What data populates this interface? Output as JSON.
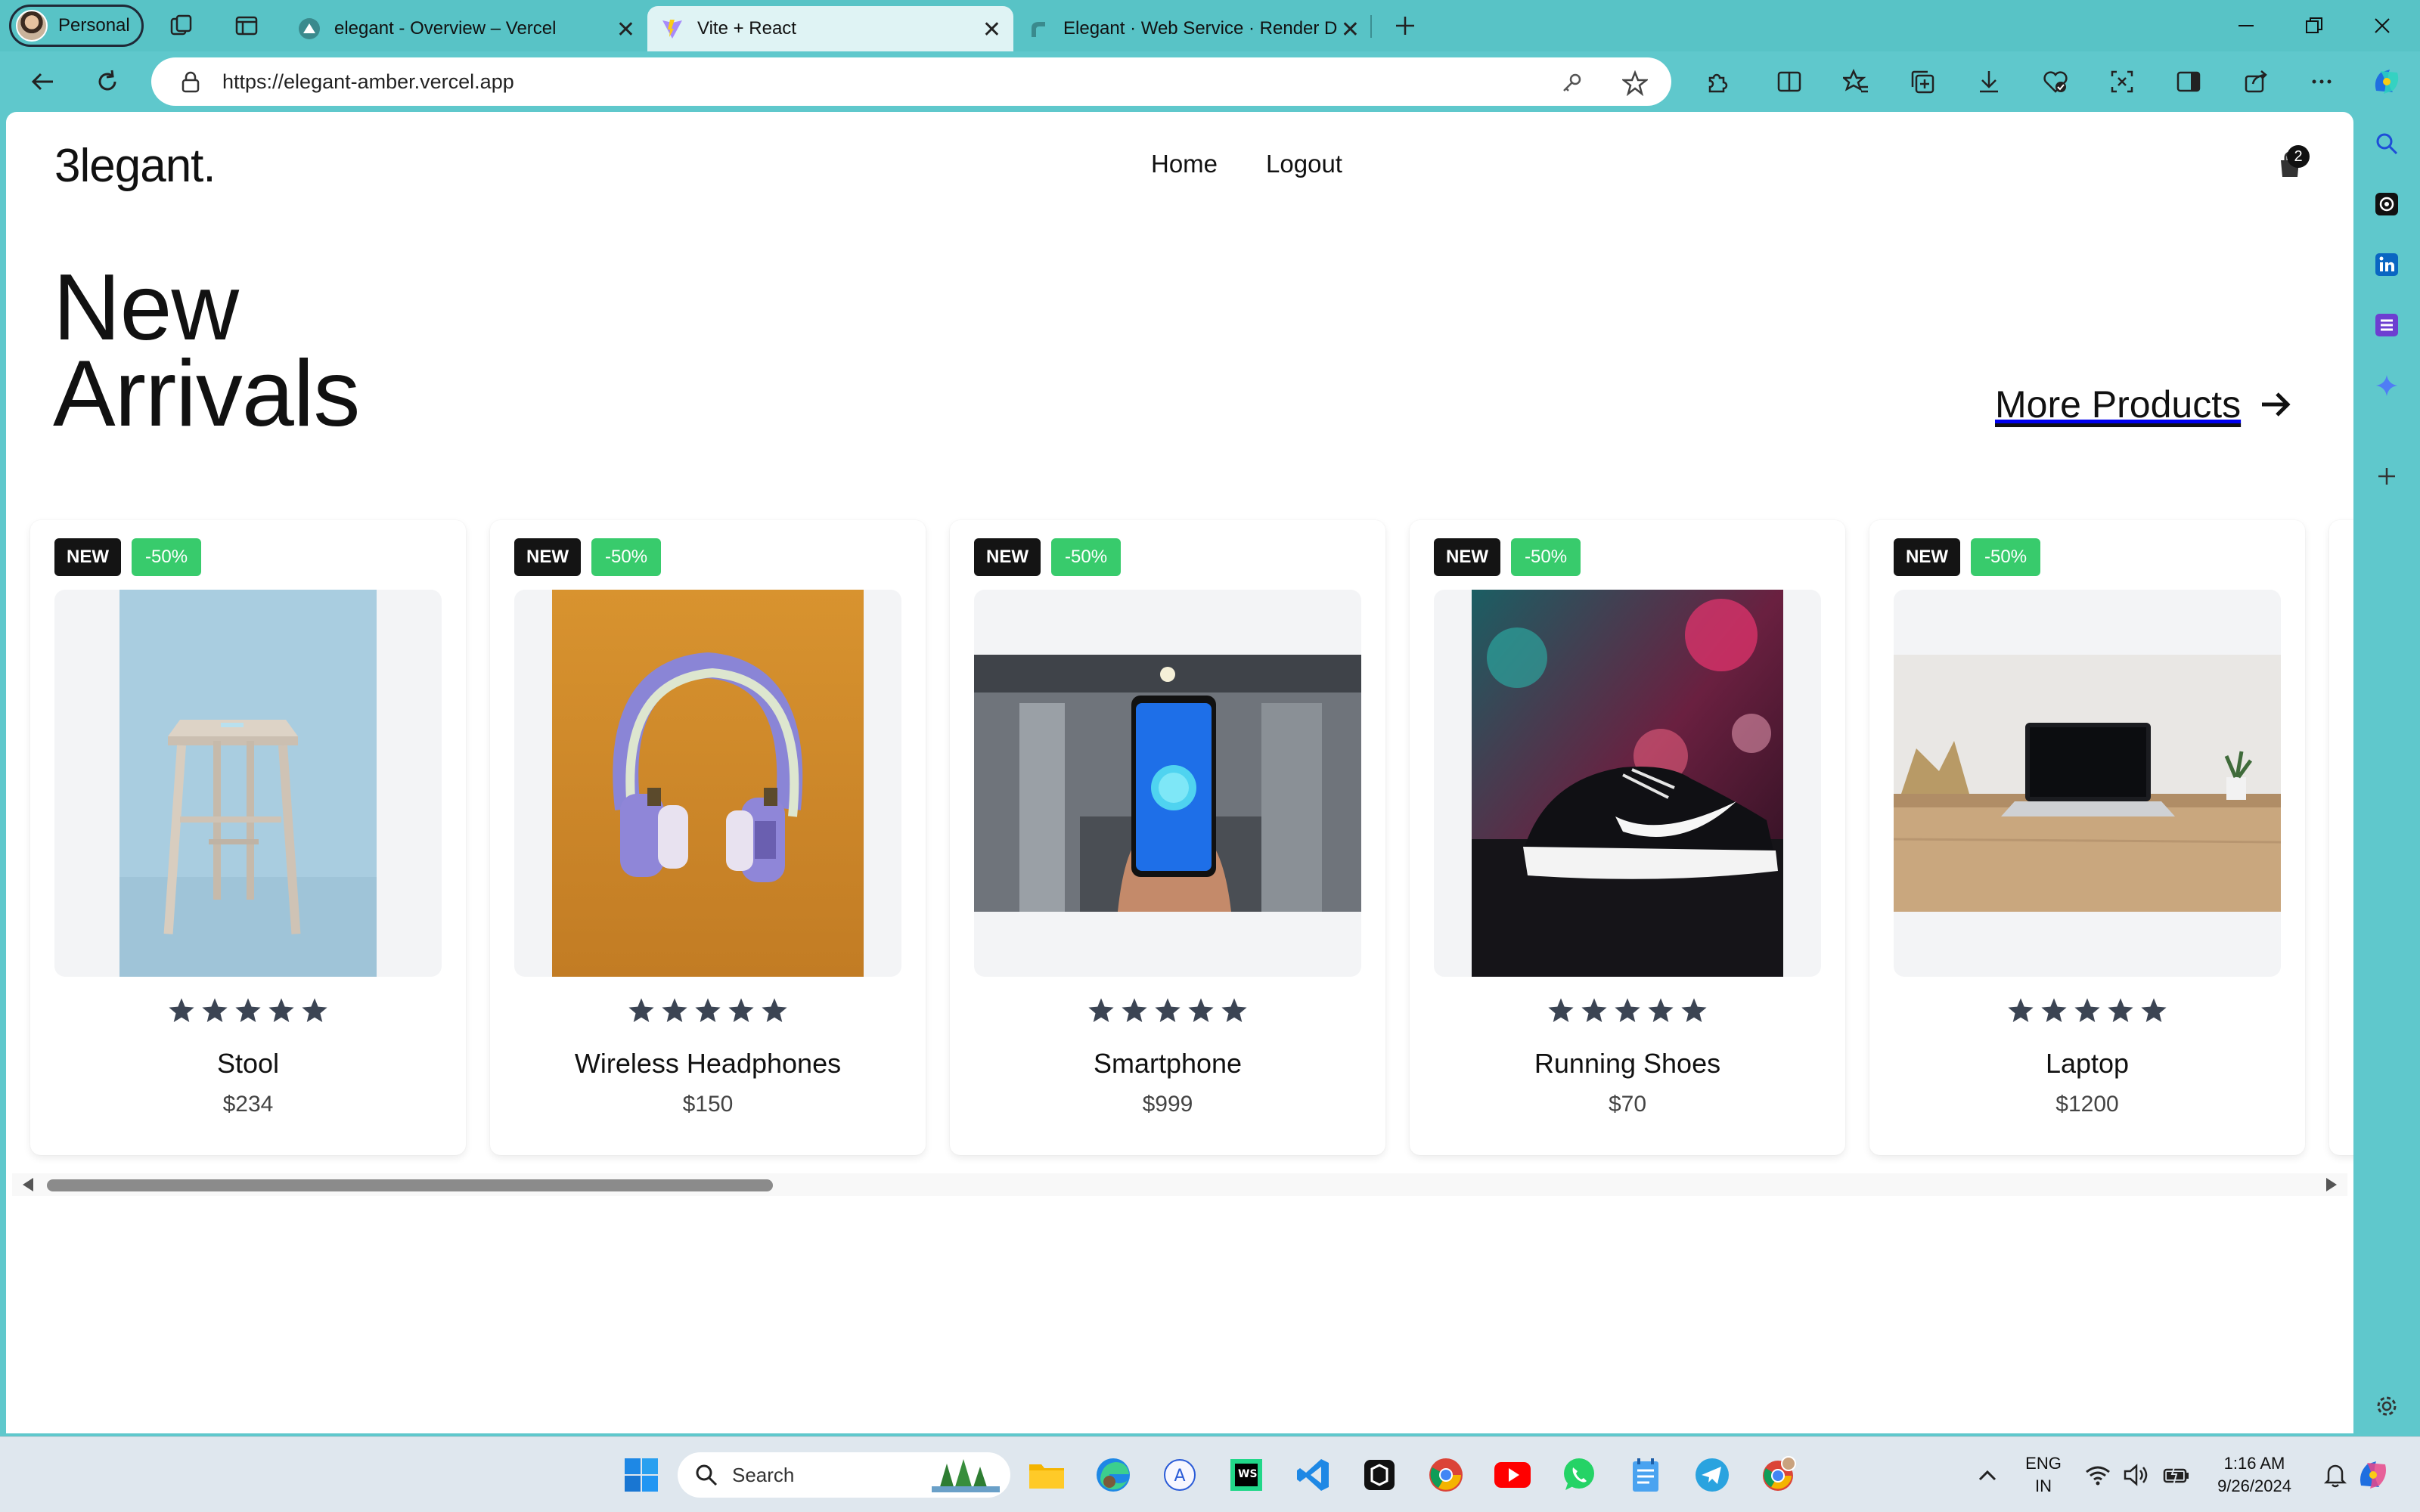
{
  "browser": {
    "profile_label": "Personal",
    "tabs": [
      {
        "title": "elegant - Overview – Vercel"
      },
      {
        "title": "Vite + React"
      },
      {
        "title": "Elegant · Web Service · Render D"
      }
    ],
    "url": "https://elegant-amber.vercel.app"
  },
  "site": {
    "logo": "3legant.",
    "nav": [
      "Home",
      "Logout"
    ],
    "cart_count": "2"
  },
  "hero": {
    "title_line1": "New",
    "title_line2": "Arrivals",
    "more_link": "More Products"
  },
  "products": [
    {
      "badge_new": "NEW",
      "badge_discount": "-50%",
      "name": "Stool",
      "price": "$234",
      "rating": 5
    },
    {
      "badge_new": "NEW",
      "badge_discount": "-50%",
      "name": "Wireless Headphones",
      "price": "$150",
      "rating": 5
    },
    {
      "badge_new": "NEW",
      "badge_discount": "-50%",
      "name": "Smartphone",
      "price": "$999",
      "rating": 5
    },
    {
      "badge_new": "NEW",
      "badge_discount": "-50%",
      "name": "Running Shoes",
      "price": "$70",
      "rating": 5
    },
    {
      "badge_new": "NEW",
      "badge_discount": "-50%",
      "name": "Laptop",
      "price": "$1200",
      "rating": 5
    }
  ],
  "taskbar": {
    "search_placeholder": "Search",
    "lang_line1": "ENG",
    "lang_line2": "IN",
    "time": "1:16 AM",
    "date": "9/26/2024"
  },
  "colors": {
    "browser_accent": "#5fc8cc",
    "discount_badge": "#38cb6c",
    "star": "#3b4453"
  }
}
